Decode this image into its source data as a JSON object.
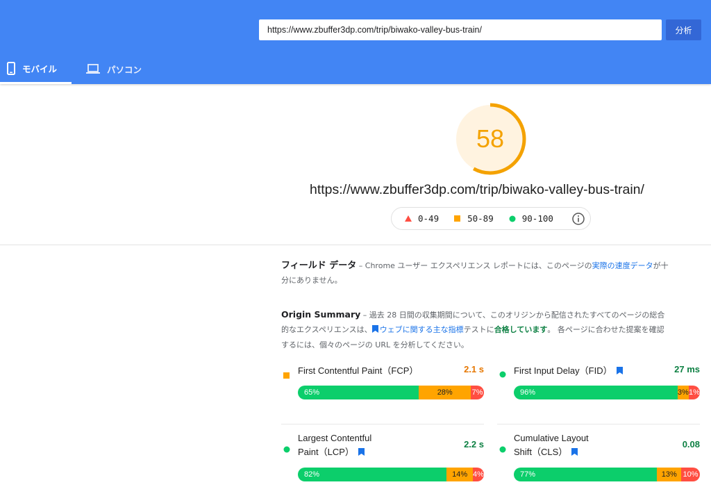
{
  "header": {
    "url_value": "https://www.zbuffer3dp.com/trip/biwako-valley-bus-train/",
    "analyze_label": "分析",
    "tabs": [
      {
        "label": "モバイル",
        "icon": "smartphone-icon",
        "active": true
      },
      {
        "label": "パソコン",
        "icon": "laptop-icon",
        "active": false
      }
    ]
  },
  "score": {
    "value": "58",
    "fraction": 0.58,
    "color": "#f4a201",
    "url": "https://www.zbuffer3dp.com/trip/biwako-valley-bus-train/"
  },
  "legend": {
    "items": [
      {
        "label": "0-49",
        "icon": "triangle-icon",
        "color": "#ff4e42"
      },
      {
        "label": "50-89",
        "icon": "square-icon",
        "color": "#ffa400"
      },
      {
        "label": "90-100",
        "icon": "circle-icon",
        "color": "#0cce6b"
      }
    ],
    "info_icon": "info-icon"
  },
  "field_data": {
    "title": "フィールド データ",
    "text_before": " – Chrome ユーザー エクスペリエンス レポートには、このページの",
    "link": "実際の速度データ",
    "text_after": "が十分にありません。"
  },
  "origin_summary": {
    "title": "Origin Summary",
    "text_1": " – 過去 28 日間の収集期間について、このオリジンから配信されたすべてのページの総合的なエクスペリエンスは、",
    "link": "ウェブに関する主な指標",
    "text_2": "テストに",
    "pass": "合格しています",
    "text_3": "。 各ページに合わせた提案を確認するには、個々のページの URL を分析してください。"
  },
  "metrics": [
    {
      "name": "First Contentful Paint（FCP）",
      "value": "2.1 s",
      "status": "average",
      "value_color": "#e67700",
      "flag": false,
      "good": "65%",
      "avg": "28%",
      "poor": "7%",
      "good_frac": 0.65,
      "avg_frac": 0.28,
      "poor_frac": 0.07
    },
    {
      "name": "First Input Delay（FID）",
      "value": "27 ms",
      "status": "good",
      "value_color": "#0d8043",
      "flag": true,
      "good": "96%",
      "avg": "3%",
      "poor": "1%",
      "good_frac": 0.96,
      "avg_frac": 0.03,
      "poor_frac": 0.01
    },
    {
      "name_line1": "Largest Contentful",
      "name_line2": "Paint（LCP）",
      "value": "2.2 s",
      "status": "good",
      "value_color": "#0d8043",
      "flag": true,
      "good": "82%",
      "avg": "14%",
      "poor": "4%",
      "good_frac": 0.82,
      "avg_frac": 0.14,
      "poor_frac": 0.04
    },
    {
      "name_line1": "Cumulative Layout",
      "name_line2": "Shift（CLS）",
      "value": "0.08",
      "status": "good",
      "value_color": "#0d8043",
      "flag": true,
      "good": "77%",
      "avg": "13%",
      "poor": "10%",
      "good_frac": 0.77,
      "avg_frac": 0.13,
      "poor_frac": 0.1
    }
  ]
}
